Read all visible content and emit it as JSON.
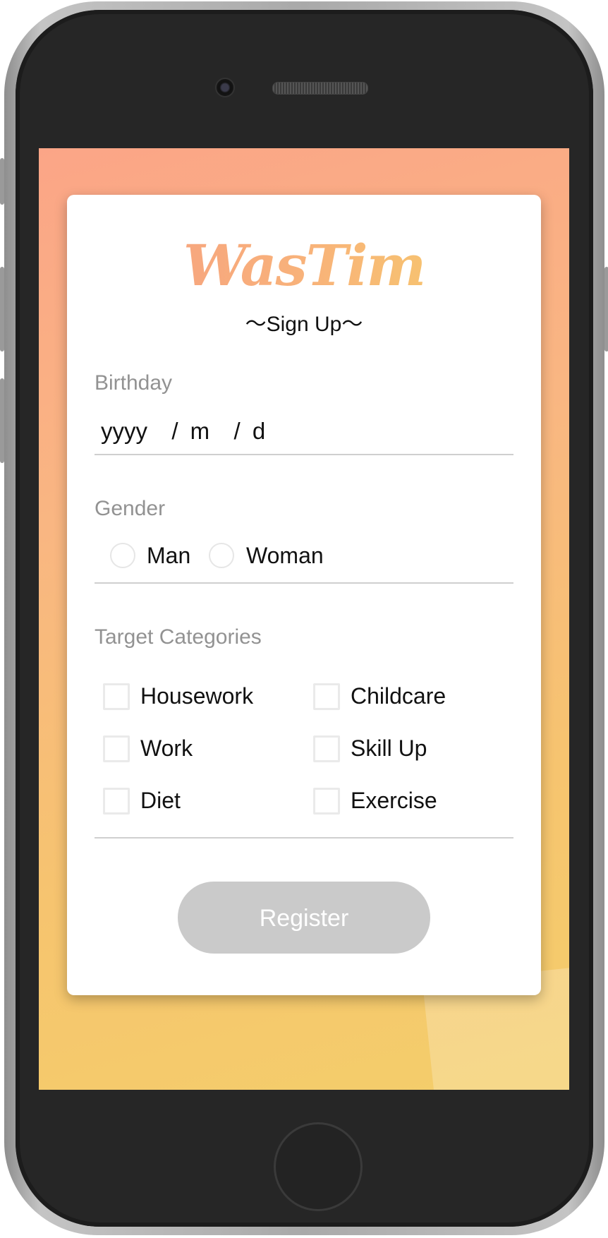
{
  "app": {
    "logo_text": "WasTim",
    "subtitle": "〜Sign Up〜"
  },
  "birthday": {
    "label": "Birthday",
    "placeholder": "yyyy  / m  / d"
  },
  "gender": {
    "label": "Gender",
    "options": [
      "Man",
      "Woman"
    ]
  },
  "categories": {
    "label": "Target Categories",
    "items": [
      "Housework",
      "Childcare",
      "Work",
      "Skill Up",
      "Diet",
      "Exercise"
    ]
  },
  "register": {
    "label": "Register"
  },
  "colors": {
    "gradient_start": "#fba587",
    "gradient_end": "#f4ce6a",
    "button_disabled": "#cacaca"
  }
}
